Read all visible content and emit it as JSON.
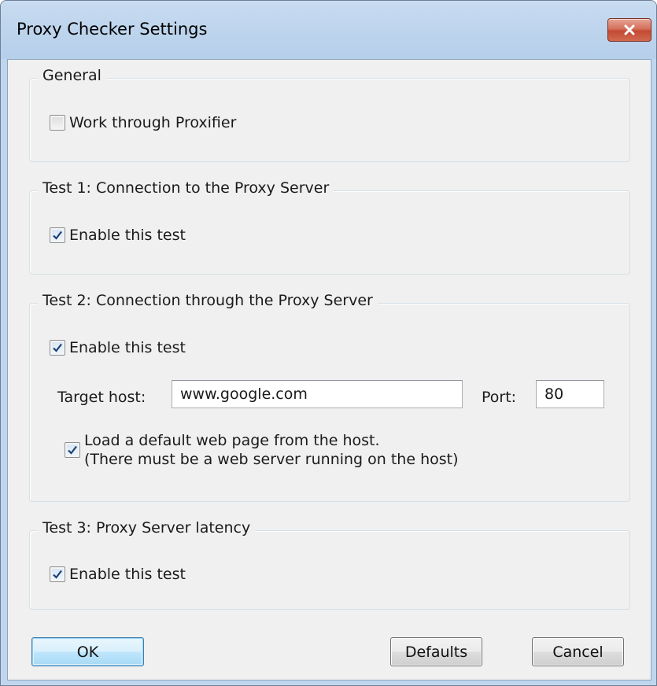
{
  "window": {
    "title": "Proxy Checker Settings"
  },
  "general": {
    "legend": "General",
    "work_through_proxifier": {
      "label": "Work through Proxifier",
      "checked": false
    }
  },
  "test1": {
    "legend": "Test 1: Connection to the Proxy Server",
    "enable": {
      "label": "Enable this test",
      "checked": true
    }
  },
  "test2": {
    "legend": "Test 2: Connection through the Proxy Server",
    "enable": {
      "label": "Enable this test",
      "checked": true
    },
    "target_host_label": "Target host:",
    "target_host_value": "www.google.com",
    "port_label": "Port:",
    "port_value": "80",
    "load_page": {
      "label_line1": "Load a default web page from the host.",
      "label_line2": "(There must be a web server running on the host)",
      "checked": true
    }
  },
  "test3": {
    "legend": "Test 3: Proxy Server latency",
    "enable": {
      "label": "Enable this test",
      "checked": true
    }
  },
  "buttons": {
    "ok": "OK",
    "defaults": "Defaults",
    "cancel": "Cancel"
  },
  "colors": {
    "accent_blue": "#3c7fb1",
    "close_red": "#c44a33",
    "check_mark": "#1c3f73"
  }
}
